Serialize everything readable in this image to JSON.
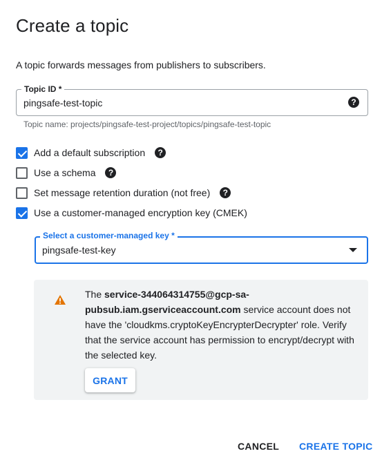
{
  "dialog": {
    "title": "Create a topic",
    "description": "A topic forwards messages from publishers to subscribers."
  },
  "topic_id": {
    "label": "Topic ID *",
    "value": "pingsafe-test-topic",
    "hint": "Topic name: projects/pingsafe-test-project/topics/pingsafe-test-topic",
    "help_icon": "?"
  },
  "options": [
    {
      "label": "Add a default subscription",
      "checked": true,
      "help": "?"
    },
    {
      "label": "Use a schema",
      "checked": false,
      "help": "?"
    },
    {
      "label": "Set message retention duration (not free)",
      "checked": false,
      "help": "?"
    },
    {
      "label": "Use a customer-managed encryption key (CMEK)",
      "checked": true
    }
  ],
  "key_select": {
    "label": "Select a customer-managed key *",
    "value": "pingsafe-test-key"
  },
  "warning": {
    "icon": "warning-icon",
    "prefix": "The ",
    "account": "service-344064314755@gcp-sa-pubsub.iam.gserviceaccount.com",
    "suffix": " service account does not have the 'cloudkms.cryptoKeyEncrypterDecrypter' role. Verify that the service account has permission to encrypt/decrypt with the selected key.",
    "grant_label": "GRANT"
  },
  "actions": {
    "cancel": "CANCEL",
    "create": "CREATE TOPIC"
  },
  "colors": {
    "accent": "#1a73e8",
    "warning": "#e37400",
    "panel": "#f1f3f4"
  }
}
